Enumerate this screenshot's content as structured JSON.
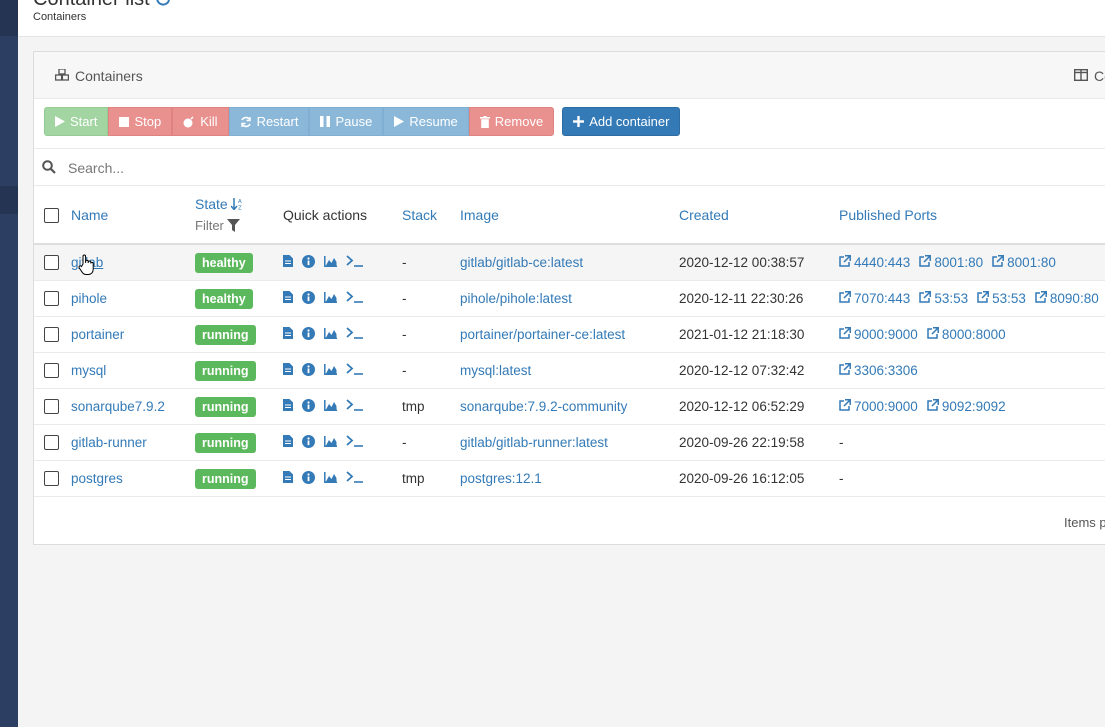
{
  "header": {
    "title": "Container list",
    "breadcrumb": "Containers"
  },
  "panel": {
    "title": "Containers",
    "columns_toggle": "Co"
  },
  "actions": {
    "start": "Start",
    "stop": "Stop",
    "kill": "Kill",
    "restart": "Restart",
    "pause": "Pause",
    "resume": "Resume",
    "remove": "Remove",
    "add_container": "Add container"
  },
  "search": {
    "placeholder": "Search..."
  },
  "table": {
    "headers": {
      "name": "Name",
      "state": "State",
      "filter": "Filter",
      "quick_actions": "Quick actions",
      "stack": "Stack",
      "image": "Image",
      "created": "Created",
      "published_ports": "Published Ports"
    },
    "rows": [
      {
        "name": "gitlab",
        "state": "healthy",
        "stack": "-",
        "image": "gitlab/gitlab-ce:latest",
        "created": "2020-12-12 00:38:57",
        "ports": [
          "4440:443",
          "8001:80",
          "8001:80"
        ]
      },
      {
        "name": "pihole",
        "state": "healthy",
        "stack": "-",
        "image": "pihole/pihole:latest",
        "created": "2020-12-11 22:30:26",
        "ports": [
          "7070:443",
          "53:53",
          "53:53",
          "8090:80"
        ]
      },
      {
        "name": "portainer",
        "state": "running",
        "stack": "-",
        "image": "portainer/portainer-ce:latest",
        "created": "2021-01-12 21:18:30",
        "ports": [
          "9000:9000",
          "8000:8000"
        ]
      },
      {
        "name": "mysql",
        "state": "running",
        "stack": "-",
        "image": "mysql:latest",
        "created": "2020-12-12 07:32:42",
        "ports": [
          "3306:3306"
        ]
      },
      {
        "name": "sonarqube7.9.2",
        "state": "running",
        "stack": "tmp",
        "image": "sonarqube:7.9.2-community",
        "created": "2020-12-12 06:52:29",
        "ports": [
          "7000:9000",
          "9092:9092"
        ]
      },
      {
        "name": "gitlab-runner",
        "state": "running",
        "stack": "-",
        "image": "gitlab/gitlab-runner:latest",
        "created": "2020-09-26 22:19:58",
        "ports": []
      },
      {
        "name": "postgres",
        "state": "running",
        "stack": "tmp",
        "image": "postgres:12.1",
        "created": "2020-09-26 16:12:05",
        "ports": []
      }
    ],
    "empty_ports": "-"
  },
  "footer": {
    "items_per_page": "Items p"
  },
  "icons": {
    "refresh": "refresh-icon",
    "containers": "cubes-icon",
    "columns": "columns-icon",
    "search": "search-icon",
    "sort": "sort-alpha-icon",
    "filter": "filter-icon",
    "logs": "file-icon",
    "inspect": "info-circle-icon",
    "stats": "area-chart-icon",
    "console": "terminal-icon",
    "external": "external-link-icon"
  },
  "colors": {
    "link": "#337ab7",
    "healthy_badge": "#5cb85c",
    "start_btn": "#a2d5a2",
    "danger_btn": "#e8918f",
    "info_btn": "#8bb8d9",
    "primary_btn": "#337ab7",
    "sidebar": "#2d3e63"
  }
}
